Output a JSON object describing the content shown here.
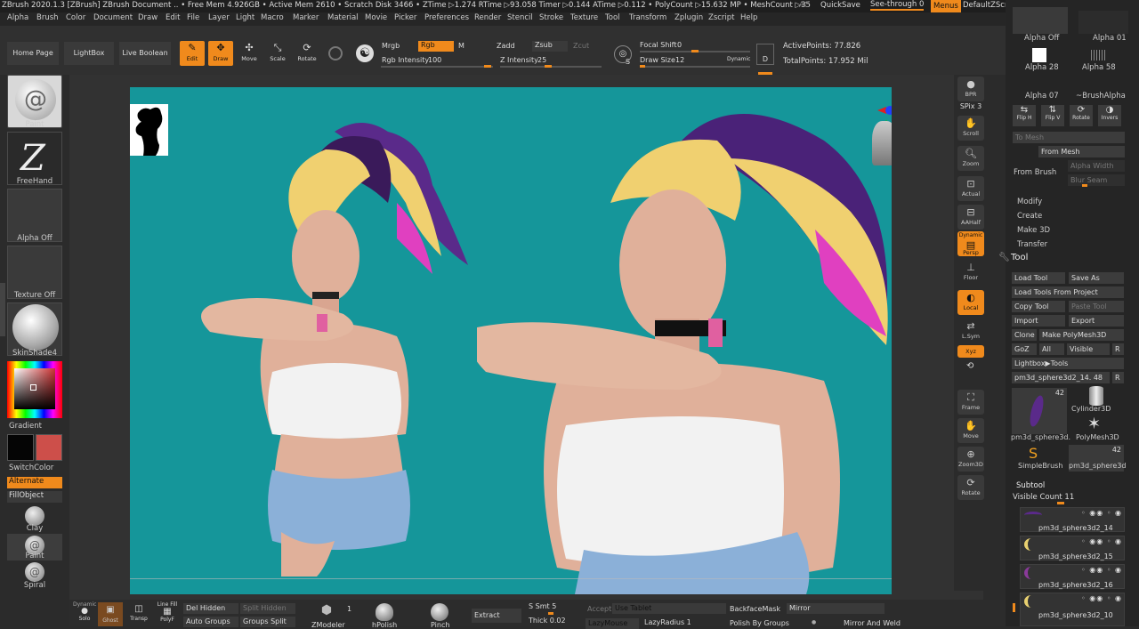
{
  "titlebar": {
    "text": "ZBrush 2020.1.3 [ZBrush]  ZBrush Document   .. • Free Mem 4.926GB • Active Mem 2610 • Scratch Disk 3466 • ZTime ▷1.274 RTime ▷93.058 Timer ▷0.144 ATime ▷0.112 • PolyCount ▷15.632 MP • MeshCount ▷35",
    "ac": "AC",
    "quicksave": "QuickSave",
    "see_through": "See-through",
    "see_through_value": "0",
    "menus": "Menus",
    "default_zscript": "DefaultZScript"
  },
  "menubar": [
    "Alpha",
    "Brush",
    "Color",
    "Document",
    "Draw",
    "Edit",
    "File",
    "Layer",
    "Light",
    "Macro",
    "Marker",
    "Material",
    "Movie",
    "Picker",
    "Preferences",
    "Render",
    "Stencil",
    "Stroke",
    "Texture",
    "Tool",
    "Transform",
    "Zplugin",
    "Zscript",
    "Help"
  ],
  "top_shelf": {
    "home_page": "Home Page",
    "lightbox": "LightBox",
    "live_boolean": "Live Boolean",
    "edit": "Edit",
    "draw": "Draw",
    "move": "Move",
    "scale": "Scale",
    "rotate": "Rotate",
    "mrgb": "Mrgb",
    "rgb": "Rgb",
    "m": "M",
    "rgb_intensity_label": "Rgb Intensity",
    "rgb_intensity_value": "100",
    "zadd": "Zadd",
    "zsub": "Zsub",
    "zcut": "Zcut",
    "z_intensity_label": "Z Intensity",
    "z_intensity_value": "25",
    "focal_shift_label": "Focal Shift",
    "focal_shift_value": "0",
    "draw_size_label": "Draw Size",
    "draw_size_value": "12",
    "dynamic": "Dynamic",
    "active_points_label": "ActivePoints:",
    "active_points_value": "77.826",
    "total_points_label": "TotalPoints:",
    "total_points_value": "17.952 Mil",
    "s_label": "S",
    "d_label": "D"
  },
  "left_shelf": {
    "paint": "Paint",
    "freehand": "FreeHand",
    "alpha_off": "Alpha Off",
    "texture_off": "Texture Off",
    "skinshade": "SkinShade4",
    "gradient": "Gradient",
    "switch_color": "SwitchColor",
    "alternate": "Alternate",
    "fill_object": "FillObject",
    "clay": "Clay",
    "paint2": "Paint",
    "spiral": "Spiral",
    "secondary_color": "#cd4f4a",
    "primary_color": "#050505"
  },
  "right_shelf": {
    "bpr": "BPR",
    "spix": "SPix",
    "spix_value": "3",
    "scroll": "Scroll",
    "zoom": "Zoom",
    "actual": "Actual",
    "aahalf": "AAHalf",
    "dynamic": "Dynamic",
    "persp": "Persp",
    "floor": "Floor",
    "local": "Local",
    "lsym": "L.Sym",
    "xyz": "Xyz",
    "frame": "Frame",
    "move": "Move",
    "zoom3d": "Zoom3D",
    "rotate": "Rotate"
  },
  "tray": {
    "alpha_off": "Alpha Off",
    "alpha_01": "Alpha 01",
    "alpha_28": "Alpha 28",
    "alpha_58": "Alpha 58",
    "alpha_07": "Alpha 07",
    "brush_alpha": "~BrushAlpha",
    "flip_h": "Flip H",
    "flip_v": "Flip V",
    "rotate": "Rotate",
    "invers": "Invers",
    "to_mesh": "To Mesh",
    "from_mesh": "From Mesh",
    "from_brush": "From Brush",
    "alpha_width": "Alpha Width",
    "blur_seam": "Blur Seam",
    "modify": "Modify",
    "create": "Create",
    "make_3d": "Make 3D",
    "transfer": "Transfer",
    "tool_header": "Tool",
    "load_tool": "Load Tool",
    "save_as": "Save As",
    "load_tools_from_project": "Load Tools From Project",
    "copy_tool": "Copy Tool",
    "paste_tool": "Paste Tool",
    "import": "Import",
    "export": "Export",
    "clone": "Clone",
    "make_polymesh": "Make PolyMesh3D",
    "goz": "GoZ",
    "all": "All",
    "visible": "Visible",
    "r": "R",
    "lightbox_tools": "Lightbox▶Tools",
    "current_tool": "pm3d_sphere3d2_14.",
    "current_tool_count": "48",
    "thumb_count_1": "42",
    "thumb_count_2": "42",
    "tool_pm3d": "pm3d_sphere3d.",
    "tool_cylinder": "Cylinder3D",
    "tool_polymesh": "PolyMesh3D",
    "tool_simplebrush": "SimpleBrush",
    "tool_pm3d2": "pm3d_sphere3d",
    "subtool": "Subtool",
    "visible_count": "Visible Count",
    "visible_count_value": "11",
    "subtools": [
      "pm3d_sphere3d2_14",
      "pm3d_sphere3d2_15",
      "pm3d_sphere3d2_16",
      "pm3d_sphere3d2_10"
    ]
  },
  "bottom_shelf": {
    "dynamic": "Dynamic",
    "solo": "Solo",
    "ghost": "Ghost",
    "transp": "Transp",
    "line_fill": "Line Fill",
    "polyf": "PolyF",
    "del_hidden": "Del Hidden",
    "split_hidden": "Split Hidden",
    "auto_groups": "Auto Groups",
    "groups_split": "Groups Split",
    "zmodeler": "ZModeler",
    "zmodeler_num": "1",
    "hpolish": "hPolish",
    "pinch": "Pinch",
    "extract": "Extract",
    "s_smt": "S Smt",
    "s_smt_value": "5",
    "thick": "Thick",
    "thick_value": "0.02",
    "accept": "Accept",
    "use_tablet": "Use Tablet",
    "lazymouse": "LazyMouse",
    "lazyradius": "LazyRadius",
    "lazyradius_value": "1",
    "backface_mask": "BackfaceMask",
    "polish_by_groups": "Polish By Groups",
    "mirror": "Mirror",
    "mirror_and_weld": "Mirror And Weld"
  },
  "colors": {
    "accent": "#f08a1c",
    "canvas": "#15969a"
  }
}
